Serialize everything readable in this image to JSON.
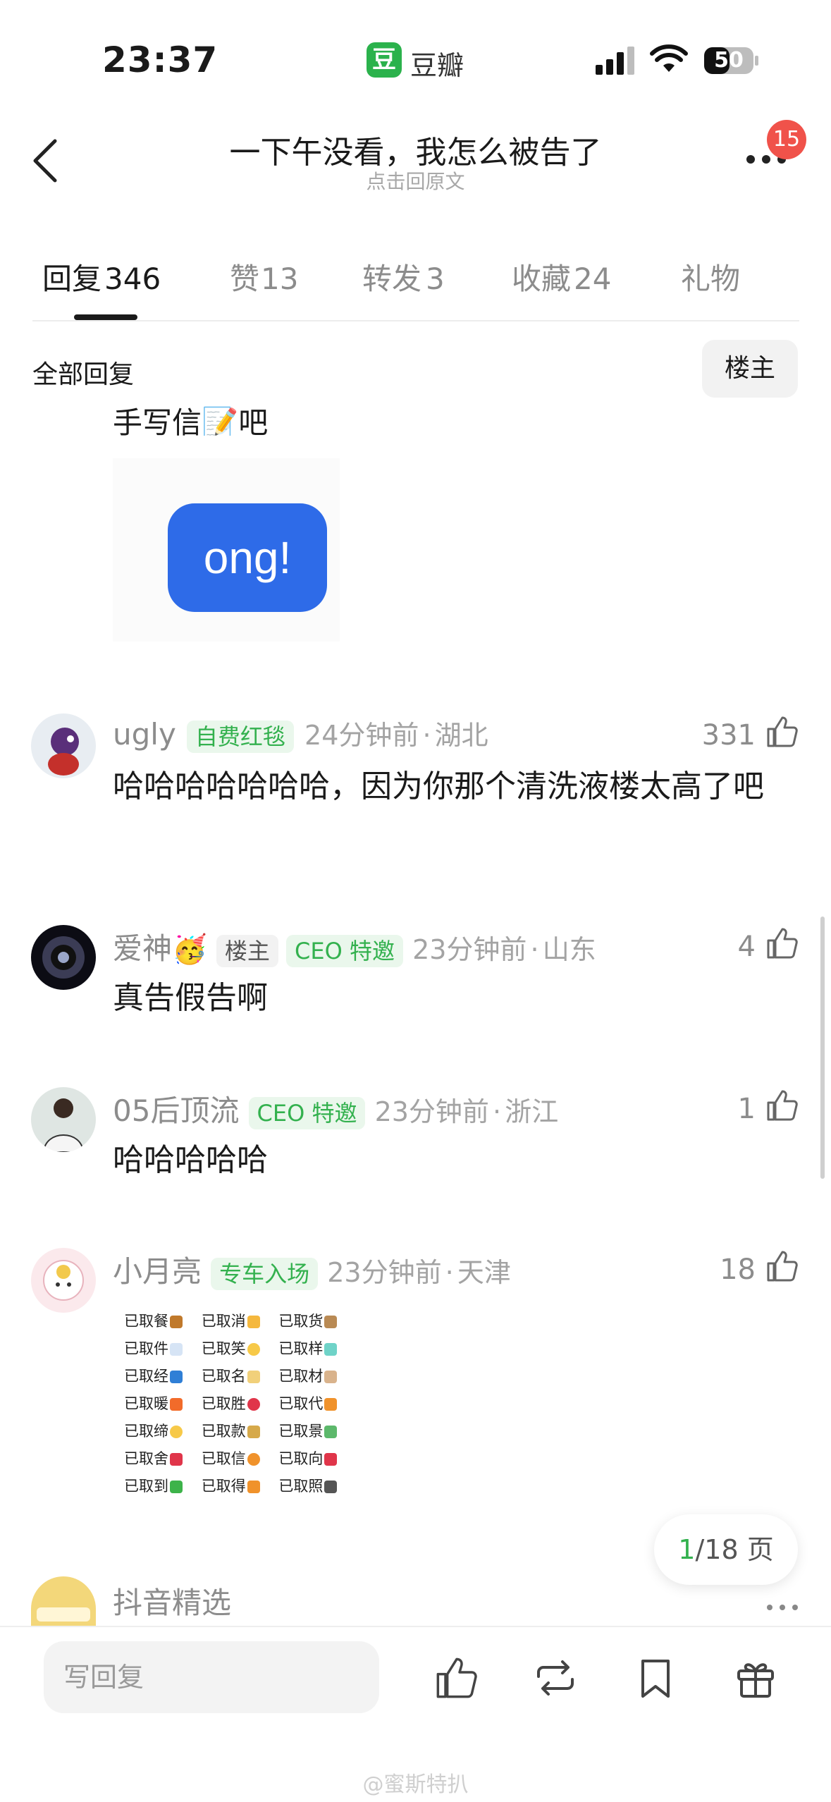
{
  "status_bar": {
    "time": "23:37",
    "app_badge": "豆",
    "app_name": "豆瓣",
    "battery": "50"
  },
  "header": {
    "title": "一下午没看，我怎么被告了",
    "subtitle": "点击回原文",
    "notification_count": "15"
  },
  "tabs": [
    {
      "label": "回复",
      "count": "346",
      "active": true
    },
    {
      "label": "赞",
      "count": "13"
    },
    {
      "label": "转发",
      "count": "3"
    },
    {
      "label": "收藏",
      "count": "24"
    },
    {
      "label": "礼物",
      "count": ""
    }
  ],
  "filter": {
    "all_label": "全部回复",
    "op_label": "楼主"
  },
  "partial_comment": {
    "text": "手写信📝吧",
    "sticker_text": "ong!"
  },
  "comments": [
    {
      "username": "ugly",
      "tags": [
        {
          "text": "自费红毯",
          "style": "green"
        }
      ],
      "time": "24分钟前",
      "location": "湖北",
      "likes": "331",
      "text": "哈哈哈哈哈哈哈，因为你那个清洗液楼太高了吧"
    },
    {
      "username": "爱神",
      "emoji": "🥳",
      "tags": [
        {
          "text": "楼主",
          "style": "grey"
        },
        {
          "text": "CEO 特邀",
          "style": "green"
        }
      ],
      "time": "23分钟前",
      "location": "山东",
      "likes": "4",
      "text": "真告假告啊"
    },
    {
      "username": "05后顶流",
      "tags": [
        {
          "text": "CEO 特邀",
          "style": "green"
        }
      ],
      "time": "23分钟前",
      "location": "浙江",
      "likes": "1",
      "text": "哈哈哈哈哈"
    },
    {
      "username": "小月亮",
      "tags": [
        {
          "text": "专车入场",
          "style": "green"
        }
      ],
      "time": "23分钟前",
      "location": "天津",
      "likes": "18",
      "sticker_rows": [
        [
          "已取餐",
          "已取消",
          "已取货"
        ],
        [
          "已取件",
          "已取笑",
          "已取样"
        ],
        [
          "已取经",
          "已取名",
          "已取材"
        ],
        [
          "已取暖",
          "已取胜",
          "已取代"
        ],
        [
          "已取缔",
          "已取款",
          "已取景"
        ],
        [
          "已取舍",
          "已取信",
          "已取向"
        ],
        [
          "已取到",
          "已取得",
          "已取照"
        ]
      ]
    },
    {
      "username": "抖音精选"
    }
  ],
  "pager": {
    "current": "1",
    "total_suffix": "/18 页"
  },
  "bottom_bar": {
    "reply_placeholder": "写回复"
  },
  "watermark": "@蜜斯特扒",
  "colors": {
    "green": "#33b14e",
    "badge_red": "#f0524a",
    "ong_blue": "#2e6be8"
  }
}
